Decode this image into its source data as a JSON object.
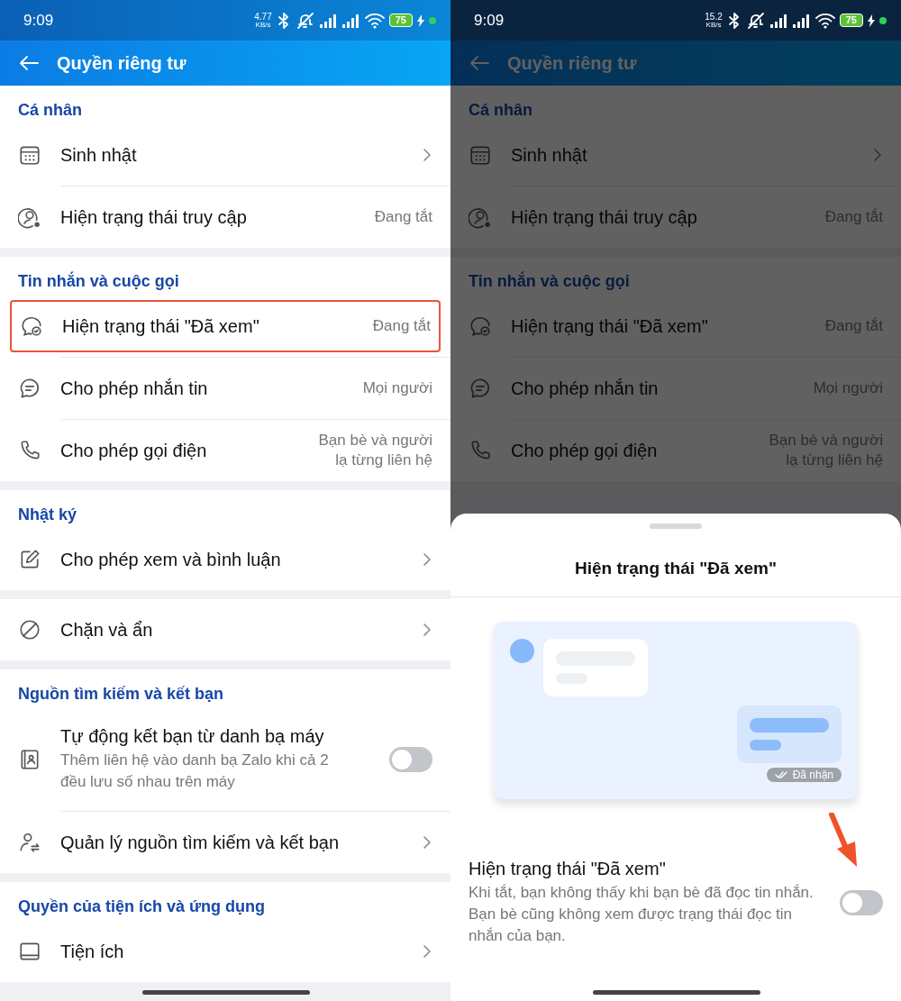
{
  "screens": [
    {
      "dimmed": false,
      "status_bar": {
        "time": "9:09",
        "speed": "4.77",
        "speed_unit": "KB/s",
        "battery": "75"
      },
      "header": {
        "title": "Quyền riêng tư"
      },
      "sections": [
        {
          "title": "Cá nhân",
          "rows": [
            {
              "kind": "link",
              "label": "Sinh nhật",
              "highlighted": false
            },
            {
              "kind": "value",
              "label": "Hiện trạng thái truy cập",
              "value": "Đang tắt",
              "highlighted": false
            }
          ]
        },
        {
          "title": "Tin nhắn và cuộc gọi",
          "rows": [
            {
              "kind": "value",
              "label": "Hiện trạng thái \"Đã xem\"",
              "value": "Đang tắt",
              "highlighted": true
            },
            {
              "kind": "value",
              "label": "Cho phép nhắn tin",
              "value": "Mọi người",
              "highlighted": false
            },
            {
              "kind": "value",
              "label": "Cho phép gọi điện",
              "value": "Bạn bè và người lạ từng liên hệ",
              "highlighted": false
            }
          ]
        },
        {
          "title": "Nhật ký",
          "rows": [
            {
              "kind": "link",
              "label": "Cho phép xem và bình luận",
              "highlighted": false
            }
          ]
        },
        {
          "rows": [
            {
              "kind": "link",
              "label": "Chặn và ẩn",
              "highlighted": false
            }
          ]
        },
        {
          "title": "Nguồn tìm kiếm và kết bạn",
          "rows": [
            {
              "kind": "toggle",
              "label": "Tự động kết bạn từ danh bạ máy",
              "description": "Thêm liên hệ vào danh bạ Zalo khi cả 2 đều lưu số nhau trên máy",
              "on": false,
              "highlighted": false
            },
            {
              "kind": "link",
              "label": "Quản lý nguồn tìm kiếm và kết bạn",
              "highlighted": false
            }
          ]
        },
        {
          "title": "Quyền của tiện ích và ứng dụng",
          "rows": [
            {
              "kind": "link",
              "label": "Tiện ích",
              "highlighted": false
            }
          ]
        }
      ]
    },
    {
      "dimmed": true,
      "status_bar": {
        "time": "9:09",
        "speed": "15.2",
        "speed_unit": "KB/s",
        "battery": "75"
      },
      "header": {
        "title": "Quyền riêng tư"
      },
      "sections": [
        {
          "title": "Cá nhân",
          "rows": [
            {
              "kind": "link",
              "label": "Sinh nhật",
              "highlighted": false
            },
            {
              "kind": "value",
              "label": "Hiện trạng thái truy cập",
              "value": "Đang tắt",
              "highlighted": false
            }
          ]
        },
        {
          "title": "Tin nhắn và cuộc gọi",
          "rows": [
            {
              "kind": "value",
              "label": "Hiện trạng thái \"Đã xem\"",
              "value": "Đang tắt",
              "highlighted": false
            },
            {
              "kind": "value",
              "label": "Cho phép nhắn tin",
              "value": "Mọi người",
              "highlighted": false
            },
            {
              "kind": "value",
              "label": "Cho phép gọi điện",
              "value": "Bạn bè và người lạ từng liên hệ",
              "highlighted": false
            }
          ]
        }
      ],
      "sheet": {
        "title": "Hiện trạng thái \"Đã xem\"",
        "preview": {
          "badge": "Đã nhận"
        },
        "setting": {
          "label": "Hiện trạng thái \"Đã xem\"",
          "description": "Khi tắt, bạn không thấy khi bạn bè đã đọc tin nhắn. Bạn bè cũng không xem được trạng thái đọc tin nhắn của bạn.",
          "on": false,
          "pointed": true
        }
      }
    }
  ]
}
